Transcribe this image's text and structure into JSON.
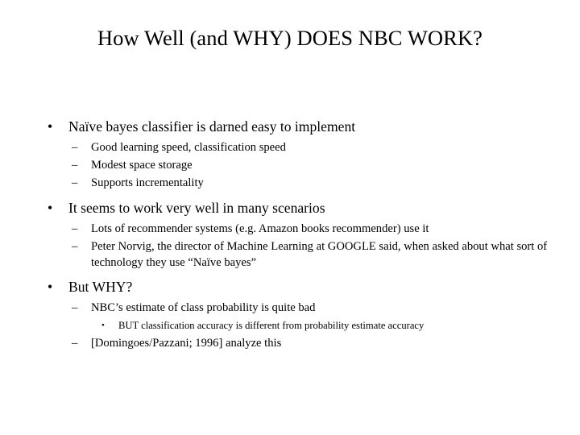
{
  "slide": {
    "background_color": "#ffffff",
    "text_color": "#000000",
    "title": "How Well (and WHY) DOES NBC WORK?",
    "bullet_glyph_level1": "•",
    "bullet_glyph_level2": "–",
    "bullet_glyph_level3": "•",
    "content": {
      "b1": {
        "text": "Naïve bayes classifier is darned easy to implement",
        "sub": [
          "Good learning speed, classification speed",
          "Modest space storage",
          "Supports incrementality"
        ]
      },
      "b2": {
        "text": "It seems to work very well in many scenarios",
        "sub": [
          "Lots of recommender systems (e.g. Amazon books recommender) use it",
          "Peter Norvig, the director of Machine Learning at GOOGLE said, when asked about what sort of technology they use “Naïve bayes”"
        ]
      },
      "b3": {
        "text": "But WHY?",
        "sub": [
          "NBC’s estimate of class probability is quite bad",
          "[Domingoes/Pazzani; 1996] analyze this"
        ],
        "subsub": [
          "BUT classification accuracy is different from probability estimate accuracy"
        ]
      }
    }
  }
}
